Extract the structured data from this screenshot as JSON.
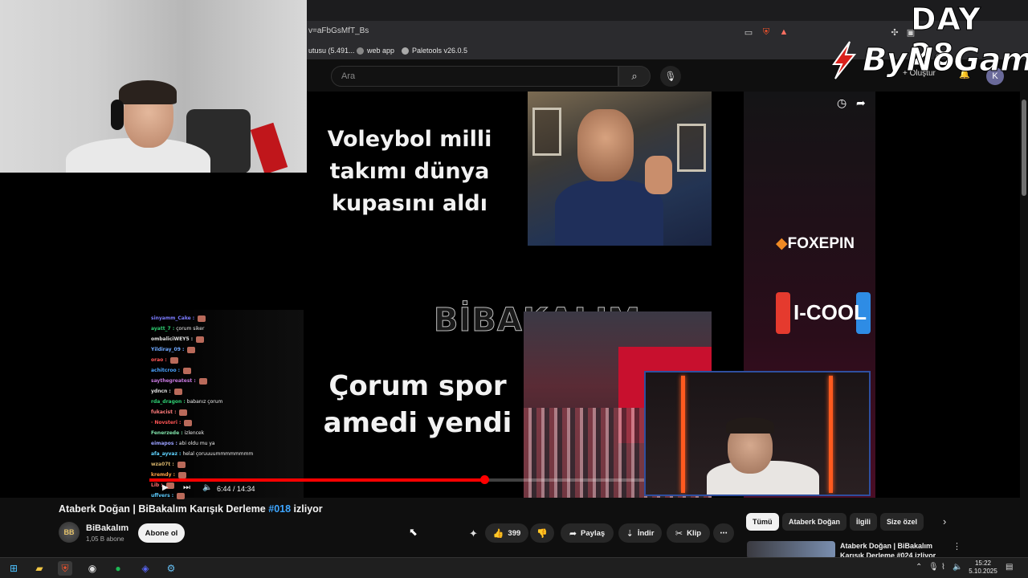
{
  "browser": {
    "url": "v=aFbGsMfT_Bs",
    "bookmarks": [
      {
        "label": "utusu (5.491..."
      },
      {
        "label": "web app"
      },
      {
        "label": "Paletools v26.0.5"
      }
    ],
    "icons": [
      "cast-icon",
      "brave-shield-icon",
      "rewards-icon",
      "extensions-icon"
    ]
  },
  "youtube_header": {
    "search_placeholder": "Ara",
    "create_label": "+ Oluştur",
    "account_initial": "K"
  },
  "video": {
    "caption_top": "Voleybol milli takımı dünya kupasını aldı",
    "caption_bottom": "Çorum spor amedi yendi",
    "watermark": "BİBAKALIM",
    "sponsor_1": "FOXEPIN",
    "sponsor_2": "I-COOL",
    "time": "6:44 / 14:34",
    "progress_fraction": 0.672
  },
  "chat": [
    {
      "user": "sinyamm_Cake :",
      "text": "",
      "color": "#7b7bff",
      "emote": true
    },
    {
      "user": "ayatt_7 :",
      "text": "çorum siker",
      "color": "#2ecc71",
      "emote": false
    },
    {
      "user": "ombaliciWEY5 :",
      "text": "",
      "color": "#e0e0e0",
      "emote": true
    },
    {
      "user": "Yildiray_09 :",
      "text": "",
      "color": "#6fa8ff",
      "emote": true
    },
    {
      "user": "orao :",
      "text": "",
      "color": "#ff5555",
      "emote": true
    },
    {
      "user": "achitcroo :",
      "text": "",
      "color": "#4aa3ff",
      "emote": true
    },
    {
      "user": "saythegreatest :",
      "text": "",
      "color": "#c678dd",
      "emote": true
    },
    {
      "user": "ydncn :",
      "text": "",
      "color": "#e0e0e0",
      "emote": true
    },
    {
      "user": "rda_dragon :",
      "text": "babanız çorum",
      "color": "#2ecc71",
      "emote": false
    },
    {
      "user": "fukacist :",
      "text": "",
      "color": "#ff7b7b",
      "emote": true
    },
    {
      "user": "· Novsteri :",
      "text": "",
      "color": "#ff5555",
      "emote": true
    },
    {
      "user": "Fenerzede :",
      "text": "izlencek",
      "color": "#7fe0a8",
      "emote": false
    },
    {
      "user": "eimapos :",
      "text": "abi oldu mu ya",
      "color": "#9aa0ff",
      "emote": false
    },
    {
      "user": "afa_ayvaz :",
      "text": "helal çoruuuummmmmmmm",
      "color": "#5fd3ff",
      "emote": false
    },
    {
      "user": "wza07t :",
      "text": "",
      "color": "#d6b36a",
      "emote": true
    },
    {
      "user": "kremdy :",
      "text": "",
      "color": "#ff9f43",
      "emote": true
    },
    {
      "user": "Lib :",
      "text": "",
      "color": "#ff6b6b",
      "emote": true
    },
    {
      "user": "uffvers :",
      "text": "",
      "color": "#5ac8fa",
      "emote": true
    }
  ],
  "video_info": {
    "title_prefix": "Ataberk Doğan | BiBakalım Karışık Derleme ",
    "hashtag": "#018",
    "title_suffix": " izliyor",
    "channel_name": "BiBakalım",
    "channel_avatar_text": "BB",
    "subscribers": "1,05 B abone",
    "subscribe_label": "Abone ol",
    "like_count": "399",
    "share_label": "Paylaş",
    "download_label": "İndir",
    "clip_label": "Klip",
    "more_label": "⋯"
  },
  "chips": [
    {
      "label": "Tümü",
      "active": true
    },
    {
      "label": "Ataberk Doğan",
      "active": false
    },
    {
      "label": "İlgili",
      "active": false
    },
    {
      "label": "Size özel",
      "active": false
    }
  ],
  "recommendation": {
    "title": "Ataberk Doğan | BiBakalım Karışık Derleme #024 izliyor"
  },
  "overlay": {
    "day_label": "DAY 28",
    "logo_text": "ByNoGame"
  },
  "taskbar": {
    "time": "15:22",
    "date": "5.10.2025",
    "apps": [
      "windows-start-icon",
      "file-explorer-icon",
      "brave-browser-icon",
      "chrome-icon",
      "spotify-icon",
      "discord-icon",
      "steam-icon"
    ]
  },
  "colors": {
    "accent_red": "#ff0000",
    "link_blue": "#3ea6ff",
    "yt_bg": "#0f0f0f"
  }
}
